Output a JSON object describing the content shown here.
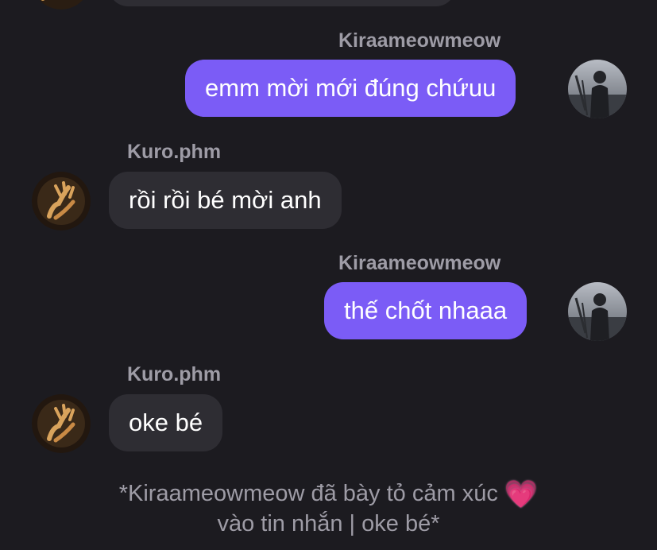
{
  "messages": [
    {
      "sender": "Kiraameowmeow",
      "text": "emm mời mới đúng chứuu",
      "direction": "outgoing"
    },
    {
      "sender": "Kuro.phm",
      "text": "rồi rồi bé mời anh",
      "direction": "incoming"
    },
    {
      "sender": "Kiraameowmeow",
      "text": "thế chốt nhaaa",
      "direction": "outgoing"
    },
    {
      "sender": "Kuro.phm",
      "text": "oke bé",
      "direction": "incoming"
    }
  ],
  "reaction_note": {
    "line1": "*Kiraameowmeow đã bày tỏ cảm xúc",
    "emoji": "💗",
    "line2": "vào tin nhắn | oke bé*"
  },
  "colors": {
    "background": "#1c1b20",
    "outgoing_bubble": "#7b5cf6",
    "incoming_bubble": "#2e2d33",
    "sender_name": "#9e9ca6"
  }
}
